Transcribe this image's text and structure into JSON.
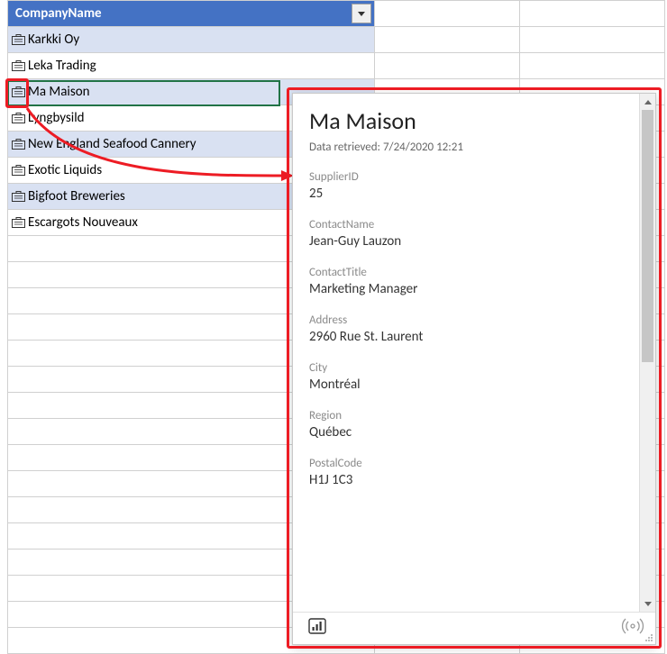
{
  "header": {
    "label": "CompanyName"
  },
  "rows": [
    {
      "label": "Karkki Oy"
    },
    {
      "label": "Leka Trading"
    },
    {
      "label": "Ma Maison"
    },
    {
      "label": "Lyngbysild"
    },
    {
      "label": "New England Seafood Cannery"
    },
    {
      "label": "Exotic Liquids"
    },
    {
      "label": "Bigfoot Breweries"
    },
    {
      "label": "Escargots Nouveaux"
    }
  ],
  "card": {
    "title": "Ma Maison",
    "retrieved_prefix": "Data retrieved: ",
    "retrieved_value": "7/24/2020 12:21",
    "fields": {
      "supplier_id": {
        "label": "SupplierID",
        "value": "25"
      },
      "contact_name": {
        "label": "ContactName",
        "value": "Jean-Guy Lauzon"
      },
      "contact_title": {
        "label": "ContactTitle",
        "value": "Marketing Manager"
      },
      "address": {
        "label": "Address",
        "value": "2960 Rue St. Laurent"
      },
      "city": {
        "label": "City",
        "value": "Montréal"
      },
      "region": {
        "label": "Region",
        "value": "Québec"
      },
      "postal_code": {
        "label": "PostalCode",
        "value": "H1J 1C3"
      }
    }
  }
}
